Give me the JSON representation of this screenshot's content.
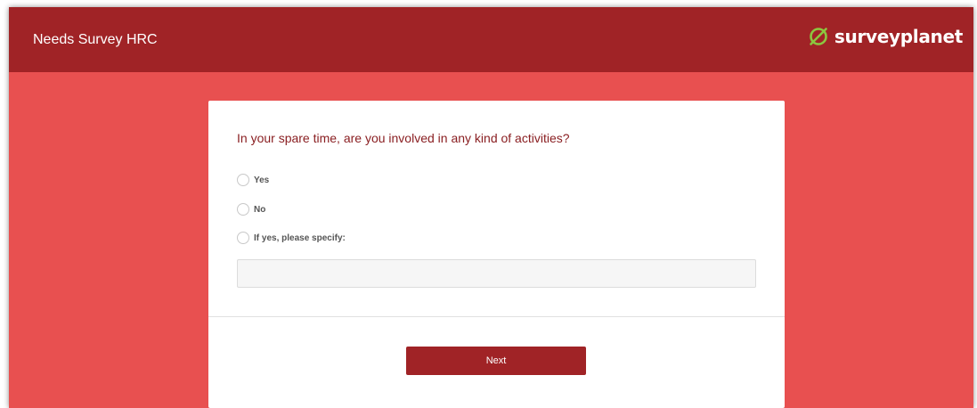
{
  "header": {
    "title": "Needs Survey HRC",
    "logo_text": "surveyplanet",
    "logo_icon": "surveyplanet-logo-icon"
  },
  "question": {
    "text": "In your spare time, are you involved in any kind of activities?",
    "options": [
      {
        "label": "Yes",
        "selected": false
      },
      {
        "label": "No",
        "selected": false
      },
      {
        "label": "If yes, please specify:",
        "selected": false
      }
    ],
    "specify_value": "",
    "specify_placeholder": ""
  },
  "actions": {
    "next_label": "Next"
  },
  "colors": {
    "header_bg": "#a02326",
    "page_bg": "#e85050",
    "question_text": "#8a1f22",
    "button_bg": "#a02326"
  }
}
